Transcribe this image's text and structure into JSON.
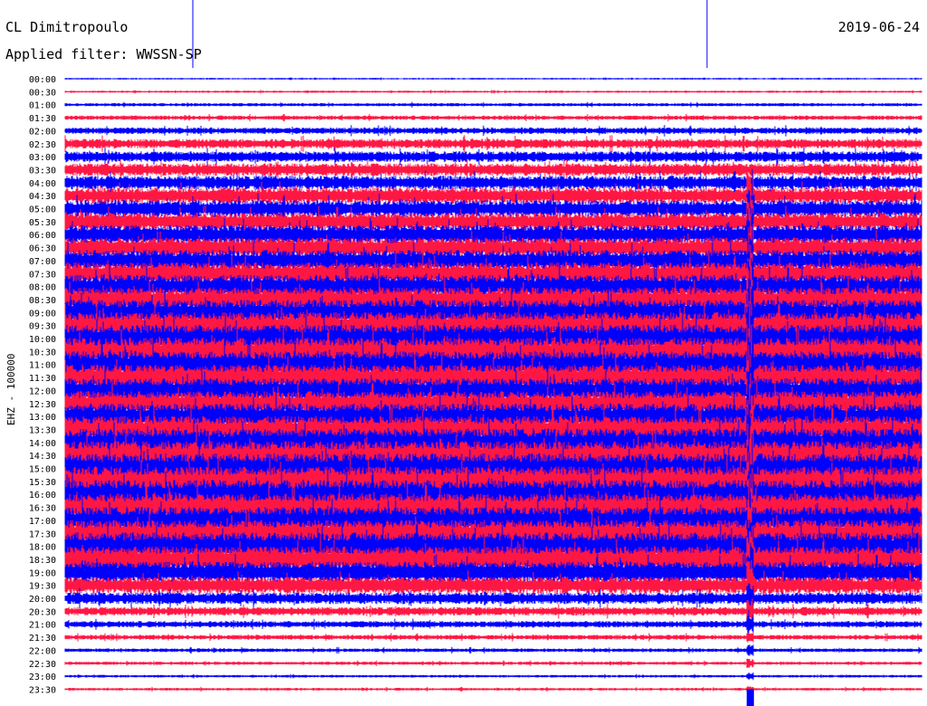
{
  "header": {
    "station": "CL Dimitropoulo",
    "date": "2019-06-24",
    "filter": "Applied filter: WWSSN-SP"
  },
  "chart_data": {
    "type": "line",
    "title": "CL Dimitropoulo",
    "date": "2019-06-24",
    "filter": "WWSSN-SP",
    "ylabel": "EHZ - 100000",
    "row_labels": [
      "00:00",
      "00:30",
      "01:00",
      "01:30",
      "02:00",
      "02:30",
      "03:00",
      "03:30",
      "04:00",
      "04:30",
      "05:00",
      "05:30",
      "06:00",
      "06:30",
      "07:00",
      "07:30",
      "08:00",
      "08:30",
      "09:00",
      "09:30",
      "10:00",
      "10:30",
      "11:00",
      "11:30",
      "12:00",
      "12:30",
      "13:00",
      "13:30",
      "14:00",
      "14:30",
      "15:00",
      "15:30",
      "16:00",
      "16:30",
      "17:00",
      "17:30",
      "18:00",
      "18:30",
      "19:00",
      "19:30",
      "20:00",
      "20:30",
      "21:00",
      "21:30",
      "22:00",
      "22:30",
      "23:00",
      "23:30"
    ],
    "row_minutes": 30,
    "trace_colors": [
      "#0000ff",
      "#ff1744"
    ],
    "relative_amplitude": [
      0.15,
      0.2,
      0.3,
      0.4,
      0.6,
      0.9,
      1.0,
      1.2,
      1.3,
      1.5,
      1.6,
      1.7,
      1.8,
      1.9,
      2.0,
      2.1,
      2.2,
      2.3,
      2.4,
      2.5,
      2.6,
      2.6,
      2.5,
      2.4,
      2.3,
      2.3,
      2.4,
      2.5,
      2.6,
      2.7,
      2.8,
      2.8,
      2.7,
      2.6,
      2.5,
      2.5,
      2.6,
      2.4,
      2.0,
      1.6,
      1.1,
      0.8,
      0.6,
      0.45,
      0.35,
      0.3,
      0.25,
      0.25
    ],
    "event_minute_offset": 24,
    "event_duration_rows": 2,
    "grid": false
  }
}
